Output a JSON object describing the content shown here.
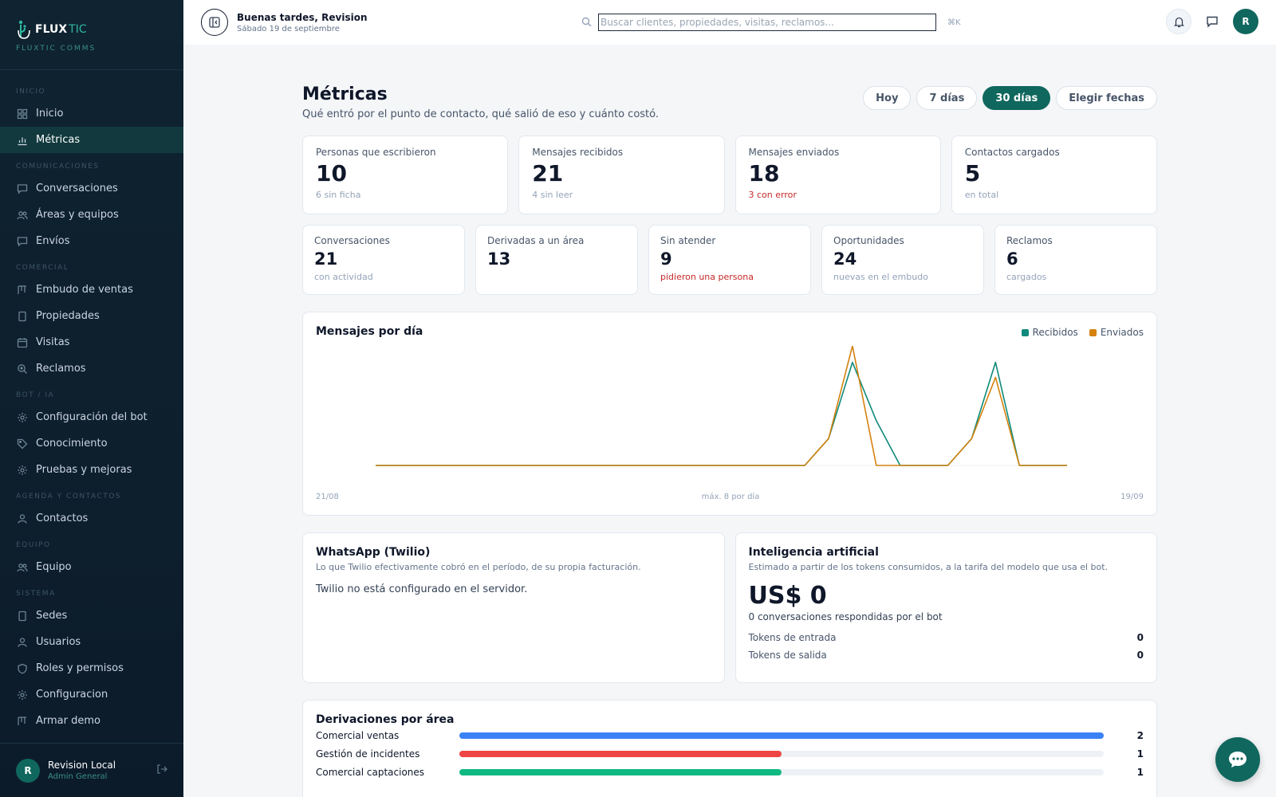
{
  "brand": {
    "name_a": "FLUX",
    "name_b": "TIC",
    "subtitle": "FLUXTIC COMMS"
  },
  "sidebar": {
    "sections": [
      {
        "label": "INICIO",
        "items": [
          {
            "label": "Inicio",
            "icon": "grid-icon"
          },
          {
            "label": "Métricas",
            "icon": "chart-icon",
            "active": true
          }
        ]
      },
      {
        "label": "COMUNICACIONES",
        "items": [
          {
            "label": "Conversaciones",
            "icon": "chat-icon"
          },
          {
            "label": "Áreas y equipos",
            "icon": "users-icon"
          },
          {
            "label": "Envíos",
            "icon": "chat-icon"
          }
        ]
      },
      {
        "label": "COMERCIAL",
        "items": [
          {
            "label": "Embudo de ventas",
            "icon": "kanban-icon"
          },
          {
            "label": "Propiedades",
            "icon": "building-icon"
          },
          {
            "label": "Visitas",
            "icon": "calendar-icon"
          },
          {
            "label": "Reclamos",
            "icon": "search-icon"
          }
        ]
      },
      {
        "label": "BOT / IA",
        "items": [
          {
            "label": "Configuración del bot",
            "icon": "gear-icon"
          },
          {
            "label": "Conocimiento",
            "icon": "tag-icon"
          },
          {
            "label": "Pruebas y mejoras",
            "icon": "gear-icon"
          }
        ]
      },
      {
        "label": "AGENDA Y CONTACTOS",
        "items": [
          {
            "label": "Contactos",
            "icon": "user-icon"
          }
        ]
      },
      {
        "label": "EQUIPO",
        "items": [
          {
            "label": "Equipo",
            "icon": "users-icon"
          }
        ]
      },
      {
        "label": "SISTEMA",
        "items": [
          {
            "label": "Sedes",
            "icon": "building-icon"
          },
          {
            "label": "Usuarios",
            "icon": "user-icon"
          },
          {
            "label": "Roles y permisos",
            "icon": "shield-icon"
          },
          {
            "label": "Configuracion",
            "icon": "gear-icon"
          },
          {
            "label": "Armar demo",
            "icon": "kanban-icon"
          }
        ]
      }
    ],
    "user": {
      "initial": "R",
      "name": "Revision Local",
      "role": "Admin General"
    }
  },
  "topbar": {
    "greeting": "Buenas tardes, Revision",
    "date": "Sábado 19 de septiembre",
    "search_placeholder": "Buscar clientes, propiedades, visitas, reclamos...",
    "shortcut": "⌘K",
    "avatar_initial": "R"
  },
  "page": {
    "title": "Métricas",
    "subtitle": "Qué entró por el punto de contacto, qué salió de eso y cuánto costó.",
    "ranges": [
      {
        "label": "Hoy",
        "active": false
      },
      {
        "label": "7 días",
        "active": false
      },
      {
        "label": "30 días",
        "active": true
      },
      {
        "label": "Elegir fechas",
        "active": false
      }
    ]
  },
  "kpis_top": [
    {
      "label": "Personas que escribieron",
      "value": "10",
      "sub": "6 sin ficha",
      "sub_error": false
    },
    {
      "label": "Mensajes recibidos",
      "value": "21",
      "sub": "4 sin leer",
      "sub_error": false
    },
    {
      "label": "Mensajes enviados",
      "value": "18",
      "sub": "3 con error",
      "sub_error": true
    },
    {
      "label": "Contactos cargados",
      "value": "5",
      "sub": "en total",
      "sub_error": false
    }
  ],
  "kpis_bottom": [
    {
      "label": "Conversaciones",
      "value": "21",
      "sub": "con actividad",
      "sub_error": false
    },
    {
      "label": "Derivadas a un área",
      "value": "13",
      "sub": "",
      "sub_error": false
    },
    {
      "label": "Sin atender",
      "value": "9",
      "sub": "pidieron una persona",
      "sub_error": true
    },
    {
      "label": "Oportunidades",
      "value": "24",
      "sub": "nuevas en el embudo",
      "sub_error": false
    },
    {
      "label": "Reclamos",
      "value": "6",
      "sub": "cargados",
      "sub_error": false
    }
  ],
  "chart_data": {
    "type": "line",
    "title": "Mensajes por día",
    "x_start_label": "21/08",
    "x_end_label": "19/09",
    "center_label": "máx. 8 por día",
    "ylim": [
      0,
      8
    ],
    "series": [
      {
        "name": "Recibidos",
        "color": "#0f8a7a",
        "values": [
          0,
          0,
          0,
          0,
          0,
          0,
          0,
          0,
          0,
          0,
          0,
          0,
          0,
          0,
          0,
          0,
          0,
          0,
          0,
          1.8,
          6.9,
          3.0,
          0,
          0,
          0,
          1.8,
          6.9,
          0,
          0,
          0
        ]
      },
      {
        "name": "Enviados",
        "color": "#d4820f",
        "values": [
          0,
          0,
          0,
          0,
          0,
          0,
          0,
          0,
          0,
          0,
          0,
          0,
          0,
          0,
          0,
          0,
          0,
          0,
          0,
          1.8,
          8,
          0,
          0,
          0,
          0,
          1.8,
          5.9,
          0,
          0,
          0
        ]
      }
    ]
  },
  "twilio": {
    "title": "WhatsApp (Twilio)",
    "desc": "Lo que Twilio efectivamente cobró en el período, de su propia facturación.",
    "message": "Twilio no está configurado en el servidor."
  },
  "ai": {
    "title": "Inteligencia artificial",
    "desc": "Estimado a partir de los tokens consumidos, a la tarifa del modelo que usa el bot.",
    "cost": "US$ 0",
    "conversations": "0 conversaciones respondidas por el bot",
    "tokens_in_label": "Tokens de entrada",
    "tokens_in": "0",
    "tokens_out_label": "Tokens de salida",
    "tokens_out": "0"
  },
  "derivaciones": {
    "title": "Derivaciones por área",
    "items": [
      {
        "name": "Comercial ventas",
        "count": 2,
        "fraction": 1.0,
        "color": "#3b82f6"
      },
      {
        "name": "Gestión de incidentes",
        "count": 1,
        "fraction": 0.5,
        "color": "#ef4444"
      },
      {
        "name": "Comercial captaciones",
        "count": 1,
        "fraction": 0.5,
        "color": "#10b981"
      }
    ]
  }
}
